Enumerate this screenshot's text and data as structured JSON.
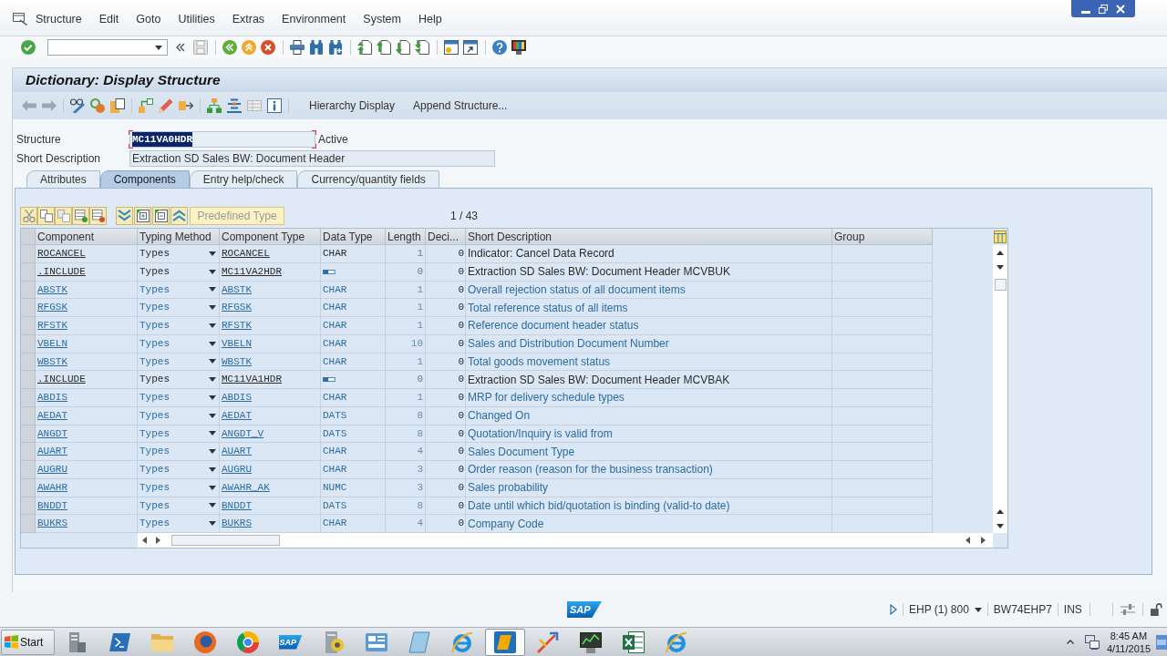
{
  "menu_bar": {
    "items": [
      "Structure",
      "Edit",
      "Goto",
      "Utilities",
      "Extras",
      "Environment",
      "System",
      "Help"
    ]
  },
  "screen_title": "Dictionary: Display Structure",
  "application_toolbar": {
    "buttons": [
      "Hierarchy Display",
      "Append Structure..."
    ]
  },
  "header": {
    "structure": {
      "label": "Structure",
      "value": "MC11VA0HDR",
      "focused": true,
      "status": "Active"
    },
    "short_description": {
      "label": "Short Description",
      "value": "Extraction SD Sales BW: Document Header"
    }
  },
  "tabs": [
    {
      "label": "Attributes",
      "selected": false
    },
    {
      "label": "Components",
      "selected": true
    },
    {
      "label": "Entry help/check",
      "selected": false
    },
    {
      "label": "Currency/quantity fields",
      "selected": false
    }
  ],
  "table_toolbar": {
    "predefined_type_button": {
      "label": "Predefined Type",
      "disabled": true
    },
    "position": "1 / 43"
  },
  "table": {
    "columns": [
      "Component",
      "Typing Method",
      "Component Type",
      "Data Type",
      "Length",
      "Deci...",
      "Short Description",
      "Group"
    ],
    "rows": [
      {
        "kind": "field",
        "from_include": false,
        "component": "ROCANCEL",
        "typing_method": "Types",
        "component_type": "ROCANCEL",
        "data_type": "CHAR",
        "length": "1",
        "decimals": "0",
        "short_description": "Indicator: Cancel Data Record"
      },
      {
        "kind": "include",
        "from_include": false,
        "component": ".INCLUDE",
        "typing_method": "Types",
        "component_type": "MC11VA2HDR",
        "length": "0",
        "decimals": "0",
        "short_description": "Extraction SD Sales BW: Document Header MCVBUK"
      },
      {
        "kind": "field",
        "from_include": true,
        "component": "ABSTK",
        "typing_method": "Types",
        "component_type": "ABSTK",
        "data_type": "CHAR",
        "length": "1",
        "decimals": "0",
        "short_description": "Overall rejection status of all document items"
      },
      {
        "kind": "field",
        "from_include": true,
        "component": "RFGSK",
        "typing_method": "Types",
        "component_type": "RFGSK",
        "data_type": "CHAR",
        "length": "1",
        "decimals": "0",
        "short_description": "Total reference status of all items"
      },
      {
        "kind": "field",
        "from_include": true,
        "component": "RFSTK",
        "typing_method": "Types",
        "component_type": "RFSTK",
        "data_type": "CHAR",
        "length": "1",
        "decimals": "0",
        "short_description": "Reference document header status"
      },
      {
        "kind": "field",
        "from_include": true,
        "component": "VBELN",
        "typing_method": "Types",
        "component_type": "VBELN",
        "data_type": "CHAR",
        "length": "10",
        "decimals": "0",
        "short_description": "Sales and Distribution Document Number"
      },
      {
        "kind": "field",
        "from_include": true,
        "component": "WBSTK",
        "typing_method": "Types",
        "component_type": "WBSTK",
        "data_type": "CHAR",
        "length": "1",
        "decimals": "0",
        "short_description": "Total goods movement status"
      },
      {
        "kind": "include",
        "from_include": false,
        "component": ".INCLUDE",
        "typing_method": "Types",
        "component_type": "MC11VA1HDR",
        "length": "0",
        "decimals": "0",
        "short_description": "Extraction SD Sales BW: Document Header MCVBAK"
      },
      {
        "kind": "field",
        "from_include": true,
        "component": "ABDIS",
        "typing_method": "Types",
        "component_type": "ABDIS",
        "data_type": "CHAR",
        "length": "1",
        "decimals": "0",
        "short_description": "MRP for delivery schedule types"
      },
      {
        "kind": "field",
        "from_include": true,
        "component": "AEDAT",
        "typing_method": "Types",
        "component_type": "AEDAT",
        "data_type": "DATS",
        "length": "8",
        "decimals": "0",
        "short_description": "Changed On"
      },
      {
        "kind": "field",
        "from_include": true,
        "component": "ANGDT",
        "typing_method": "Types",
        "component_type": "ANGDT_V",
        "data_type": "DATS",
        "length": "8",
        "decimals": "0",
        "short_description": "Quotation/Inquiry is valid from"
      },
      {
        "kind": "field",
        "from_include": true,
        "component": "AUART",
        "typing_method": "Types",
        "component_type": "AUART",
        "data_type": "CHAR",
        "length": "4",
        "decimals": "0",
        "short_description": "Sales Document Type"
      },
      {
        "kind": "field",
        "from_include": true,
        "component": "AUGRU",
        "typing_method": "Types",
        "component_type": "AUGRU",
        "data_type": "CHAR",
        "length": "3",
        "decimals": "0",
        "short_description": "Order reason (reason for the business transaction)"
      },
      {
        "kind": "field",
        "from_include": true,
        "component": "AWAHR",
        "typing_method": "Types",
        "component_type": "AWAHR_AK",
        "data_type": "NUMC",
        "length": "3",
        "decimals": "0",
        "short_description": "Sales probability"
      },
      {
        "kind": "field",
        "from_include": true,
        "component": "BNDDT",
        "typing_method": "Types",
        "component_type": "BNDDT",
        "data_type": "DATS",
        "length": "8",
        "decimals": "0",
        "short_description": "Date until which bid/quotation is binding (valid-to date)"
      },
      {
        "kind": "field",
        "from_include": true,
        "component": "BUKRS",
        "typing_method": "Types",
        "component_type": "BUKRS",
        "data_type": "CHAR",
        "length": "4",
        "decimals": "0",
        "short_description": "Company Code"
      }
    ]
  },
  "status_bar": {
    "logo": "SAP",
    "system": "EHP (1) 800",
    "server": "BW74EHP7",
    "mode": "INS"
  },
  "taskbar": {
    "start": "Start",
    "apps": [
      {
        "kind": "server",
        "selected": false
      },
      {
        "kind": "terminal",
        "selected": false
      },
      {
        "kind": "folder",
        "selected": false
      },
      {
        "kind": "globe",
        "selected": false
      },
      {
        "kind": "segmented",
        "selected": false
      },
      {
        "kind": "sap",
        "label": "SAP",
        "selected": false
      },
      {
        "kind": "gears",
        "selected": false
      },
      {
        "kind": "panel",
        "selected": false
      },
      {
        "kind": "note",
        "selected": false
      },
      {
        "kind": "browser",
        "selected": false
      },
      {
        "kind": "logon",
        "selected": true
      },
      {
        "kind": "arrows",
        "selected": false
      },
      {
        "kind": "monitor",
        "selected": false
      },
      {
        "kind": "sheet",
        "selected": false
      },
      {
        "kind": "browser",
        "selected": false
      }
    ],
    "time": "8:45 AM",
    "date": "4/11/2015"
  }
}
